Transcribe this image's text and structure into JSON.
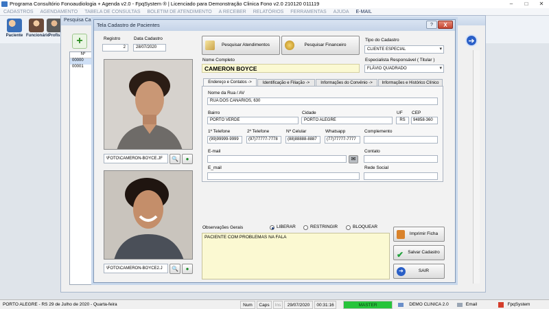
{
  "app": {
    "title": "Programa Consultório Fonoaudiologia + Agenda v2.0 - FpqSystem ® | Licenciado para  Demonstração Clinica Fono v2.0 210120 011119"
  },
  "menu": [
    "CADASTROS",
    "AGENDAMENTO",
    "TABELA DE CONSULTAS",
    "BOLETIM DE ATENDIMENTO",
    "A RECEBER",
    "RELATÓRIOS",
    "FERRAMENTAS",
    "AJUDA",
    "E-MAIL"
  ],
  "toolbar": [
    {
      "label": "Paciente",
      "color": "#c9a27a"
    },
    {
      "label": "Funcionário",
      "color": "#b88e6c"
    },
    {
      "label": "Profis",
      "color": "#8a6a56"
    }
  ],
  "bgwin": {
    "title": "Pesquisa Cad",
    "grid_header": "Nº",
    "rows": [
      "00000",
      "00001"
    ]
  },
  "dialog": {
    "title": "Tela Cadastro de Pacientes",
    "help": "?",
    "close": "X",
    "registro_label": "Registro",
    "registro_value": "2",
    "data_label": "Data Cadastro",
    "data_value": "28/07/2020",
    "btn_atendimentos": "Pesquisar  Atendimentos",
    "btn_financeiro": "Pesquisar  Financeiro",
    "tipo_label": "Tipo do Cadastro",
    "tipo_value": "CLIENTE ESPECIAL",
    "nome_label": "Nome Completo",
    "nome_value": "CAMERON BOYCE",
    "resp_label": "Especialista Responsável ( Titular )",
    "resp_value": "FLÁVIO QUADRADO",
    "photo1_path": "\\FOTO\\CAMERON-BOYCE.JF",
    "photo2_path": "\\FOTO\\CAMERON-BOYCE2.J",
    "tabs": [
      "Endereço e Contatos ->",
      "Identificação e Filiação ->",
      "Informações do Convênio ->",
      "Informações e Histórico Clínico"
    ],
    "rua_label": "Nome da Rua / AV",
    "rua_value": "RUA DOS CANARIOS, 630",
    "bairro_label": "Bairro",
    "bairro_value": "PORTO VERDE",
    "cidade_label": "Cidade",
    "cidade_value": "PORTO ALEGRE",
    "uf_label": "UF",
    "uf_value": "RS",
    "cep_label": "CEP",
    "cep_value": "94858-360",
    "tel1_label": "1º Telefone",
    "tel1_value": "(99)99999-9999",
    "tel2_label": "2º Telefone",
    "tel2_value": "(97)77777-7778",
    "cel_label": "Nº Celular",
    "cel_value": "(88)88888-8887",
    "whats_label": "Whatsapp",
    "whats_value": "(77)77777-7777",
    "compl_label": "Complemento",
    "compl_value": "",
    "email_label": "E-mail",
    "email_value": "",
    "contato_label": "Contato",
    "contato_value": "",
    "email2_label": "E_mail",
    "email2_value": "",
    "rede_label": "Rede Social",
    "rede_value": "",
    "obs_label": "Observações Gerais",
    "radio_liberar": "LIBERAR",
    "radio_restringir": "RESTRINGIR",
    "radio_bloquear": "BLOQUEAR",
    "obs_value": "PACIENTE COM PROBLEMAS NA FALA",
    "btn_imprimir": "Imprimir Ficha",
    "btn_salvar": "Salvar Cadastro",
    "btn_sair": "SAIR"
  },
  "status": {
    "location": "PORTO ALEGRE - RS 29 de Julho de 2020 - Quarta-feira",
    "num": "Num",
    "caps": "Caps",
    "ins": "Ins",
    "date": "29/07/2020",
    "time": "00:31:16",
    "master": "MASTER",
    "company": "DEMO CLINICA 2.0",
    "email": "Email",
    "brand": "FpqSystem",
    "master_color": "#27c43a"
  }
}
